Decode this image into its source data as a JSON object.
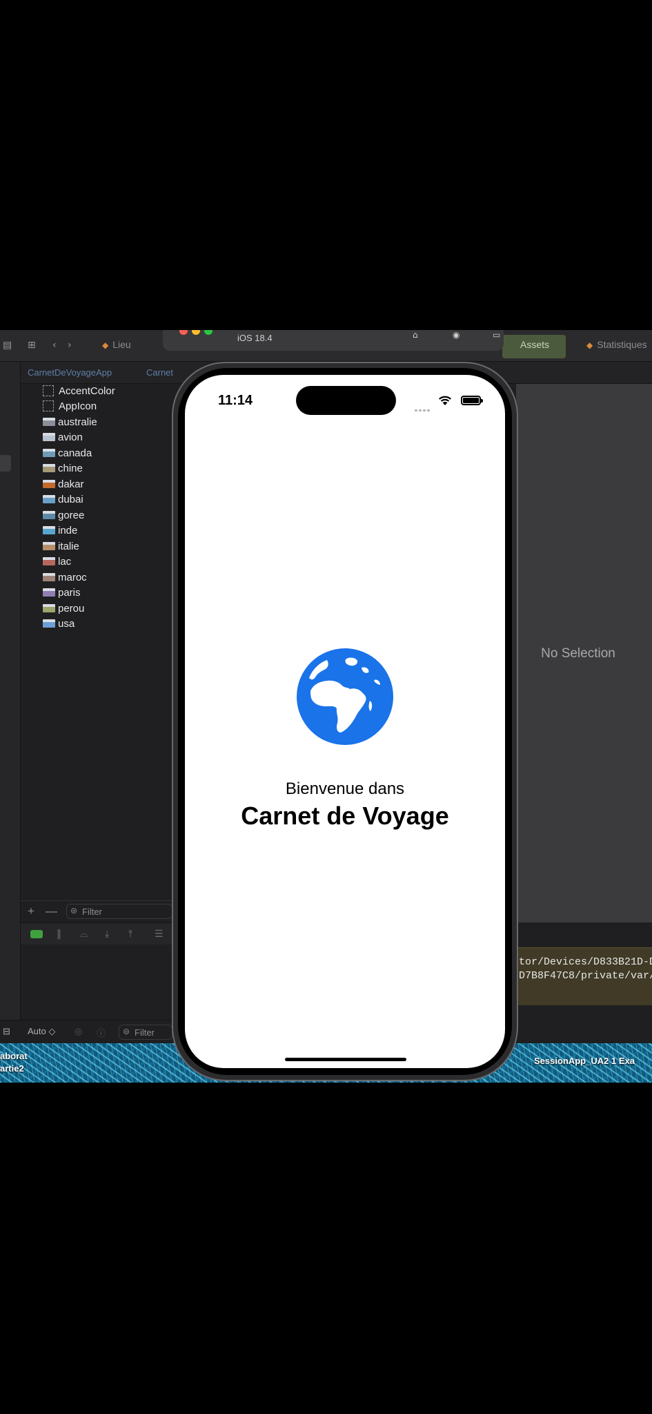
{
  "xcode": {
    "tabs": [
      "Lieu",
      "Assets",
      "Statistiques"
    ],
    "breadcrumb": [
      "CarnetDeVoyageApp",
      "Carnet"
    ],
    "simulator": {
      "os_version": "iOS 18.4"
    },
    "assets": [
      {
        "name": "AccentColor",
        "kind": "color"
      },
      {
        "name": "AppIcon",
        "kind": "icon"
      },
      {
        "name": "australie",
        "kind": "image",
        "thumb": "#8a8f99"
      },
      {
        "name": "avion",
        "kind": "image",
        "thumb": "#b9c3d0"
      },
      {
        "name": "canada",
        "kind": "image",
        "thumb": "#6f9bb8"
      },
      {
        "name": "chine",
        "kind": "image",
        "thumb": "#a49a78"
      },
      {
        "name": "dakar",
        "kind": "image",
        "thumb": "#c46a2e"
      },
      {
        "name": "dubai",
        "kind": "image",
        "thumb": "#6aa0c8"
      },
      {
        "name": "goree",
        "kind": "image",
        "thumb": "#5d8aa8"
      },
      {
        "name": "inde",
        "kind": "image",
        "thumb": "#58a6cf"
      },
      {
        "name": "italie",
        "kind": "image",
        "thumb": "#b88f6a"
      },
      {
        "name": "lac",
        "kind": "image",
        "thumb": "#b5675e"
      },
      {
        "name": "maroc",
        "kind": "image",
        "thumb": "#9e8278"
      },
      {
        "name": "paris",
        "kind": "image",
        "thumb": "#8f7fb0"
      },
      {
        "name": "perou",
        "kind": "image",
        "thumb": "#9aa66d"
      },
      {
        "name": "usa",
        "kind": "image",
        "thumb": "#6e9ed6"
      }
    ],
    "filter_placeholder": "Filter",
    "add_label": "+",
    "remove_label": "—",
    "auto_label": "Auto ◇",
    "inspector_text": "No Selection",
    "console_lines": [
      "tor/Devices/D833B21D-D",
      "D7B8F47C8/private/var/"
    ],
    "desktop_labels": {
      "left_top": "aborat",
      "left_bottom": "artie2",
      "right": "SessionApp_UA2 1  Exa"
    }
  },
  "phone": {
    "status_time": "11:14",
    "welcome_text": "Bienvenue dans",
    "app_title": "Carnet de Voyage",
    "globe_color": "#1a73e8"
  }
}
